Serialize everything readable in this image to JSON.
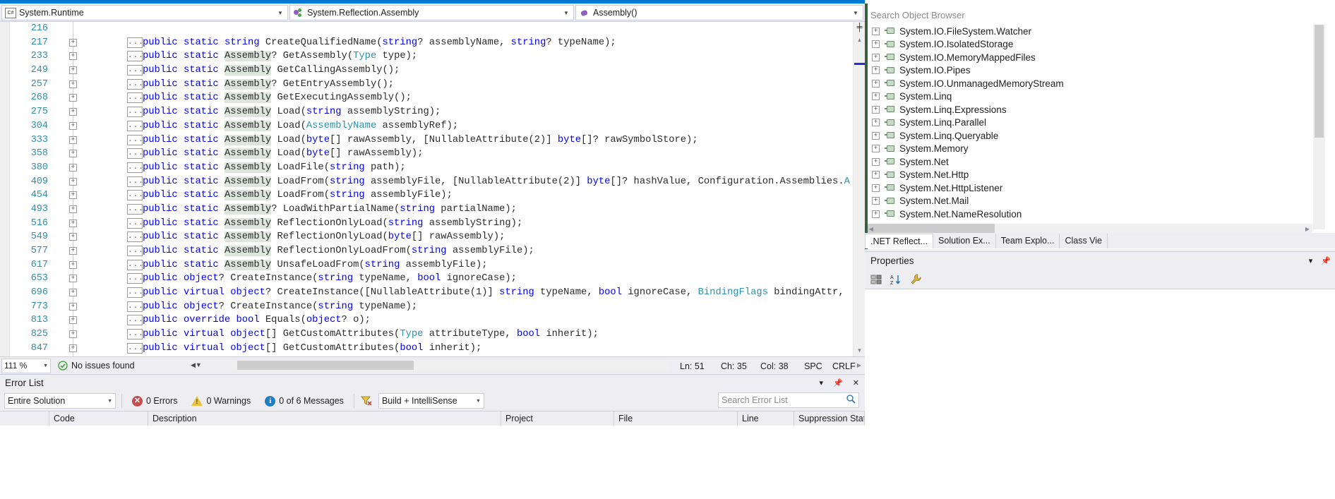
{
  "navbar": {
    "project": {
      "label": "System.Runtime",
      "icon": "csharp-icon"
    },
    "type": {
      "label": "System.Reflection.Assembly",
      "icon": "class-icon"
    },
    "member": {
      "label": "Assembly()",
      "icon": "method-icon"
    }
  },
  "editor": {
    "lines": [
      {
        "num": "216",
        "outline": false,
        "collapse": false,
        "tokens": []
      },
      {
        "num": "217",
        "outline": true,
        "collapse": true,
        "tokens": [
          {
            "t": "public ",
            "c": "k"
          },
          {
            "t": "static ",
            "c": "k"
          },
          {
            "t": "string",
            "c": "k"
          },
          {
            "t": " CreateQualifiedName(",
            "c": "id"
          },
          {
            "t": "string",
            "c": "k"
          },
          {
            "t": "? assemblyName, ",
            "c": "id"
          },
          {
            "t": "string",
            "c": "k"
          },
          {
            "t": "? typeName);",
            "c": "id"
          }
        ]
      },
      {
        "num": "233",
        "outline": true,
        "collapse": true,
        "tokens": [
          {
            "t": "public ",
            "c": "k"
          },
          {
            "t": "static ",
            "c": "k"
          },
          {
            "t": "Assembly",
            "c": "hl"
          },
          {
            "t": "? GetAssembly(",
            "c": "id"
          },
          {
            "t": "Type",
            "c": "t"
          },
          {
            "t": " type);",
            "c": "id"
          }
        ]
      },
      {
        "num": "249",
        "outline": true,
        "collapse": true,
        "tokens": [
          {
            "t": "public ",
            "c": "k"
          },
          {
            "t": "static ",
            "c": "k"
          },
          {
            "t": "Assembly",
            "c": "hl"
          },
          {
            "t": " GetCallingAssembly();",
            "c": "id"
          }
        ]
      },
      {
        "num": "257",
        "outline": true,
        "collapse": true,
        "tokens": [
          {
            "t": "public ",
            "c": "k"
          },
          {
            "t": "static ",
            "c": "k"
          },
          {
            "t": "Assembly",
            "c": "hl"
          },
          {
            "t": "? GetEntryAssembly();",
            "c": "id"
          }
        ]
      },
      {
        "num": "268",
        "outline": true,
        "collapse": true,
        "tokens": [
          {
            "t": "public ",
            "c": "k"
          },
          {
            "t": "static ",
            "c": "k"
          },
          {
            "t": "Assembly",
            "c": "hl"
          },
          {
            "t": " GetExecutingAssembly();",
            "c": "id"
          }
        ]
      },
      {
        "num": "275",
        "outline": true,
        "collapse": true,
        "tokens": [
          {
            "t": "public ",
            "c": "k"
          },
          {
            "t": "static ",
            "c": "k"
          },
          {
            "t": "Assembly",
            "c": "hl"
          },
          {
            "t": " Load(",
            "c": "id"
          },
          {
            "t": "string",
            "c": "k"
          },
          {
            "t": " assemblyString);",
            "c": "id"
          }
        ]
      },
      {
        "num": "304",
        "outline": true,
        "collapse": true,
        "tokens": [
          {
            "t": "public ",
            "c": "k"
          },
          {
            "t": "static ",
            "c": "k"
          },
          {
            "t": "Assembly",
            "c": "hl"
          },
          {
            "t": " Load(",
            "c": "id"
          },
          {
            "t": "AssemblyName",
            "c": "t"
          },
          {
            "t": " assemblyRef);",
            "c": "id"
          }
        ]
      },
      {
        "num": "333",
        "outline": true,
        "collapse": true,
        "tokens": [
          {
            "t": "public ",
            "c": "k"
          },
          {
            "t": "static ",
            "c": "k"
          },
          {
            "t": "Assembly",
            "c": "hl"
          },
          {
            "t": " Load(",
            "c": "id"
          },
          {
            "t": "byte",
            "c": "k"
          },
          {
            "t": "[] rawAssembly, [NullableAttribute(2)] ",
            "c": "id"
          },
          {
            "t": "byte",
            "c": "k"
          },
          {
            "t": "[]? rawSymbolStore);",
            "c": "id"
          }
        ]
      },
      {
        "num": "358",
        "outline": true,
        "collapse": true,
        "tokens": [
          {
            "t": "public ",
            "c": "k"
          },
          {
            "t": "static ",
            "c": "k"
          },
          {
            "t": "Assembly",
            "c": "hl"
          },
          {
            "t": " Load(",
            "c": "id"
          },
          {
            "t": "byte",
            "c": "k"
          },
          {
            "t": "[] rawAssembly);",
            "c": "id"
          }
        ]
      },
      {
        "num": "380",
        "outline": true,
        "collapse": true,
        "tokens": [
          {
            "t": "public ",
            "c": "k"
          },
          {
            "t": "static ",
            "c": "k"
          },
          {
            "t": "Assembly",
            "c": "hl"
          },
          {
            "t": " LoadFile(",
            "c": "id"
          },
          {
            "t": "string",
            "c": "k"
          },
          {
            "t": " path);",
            "c": "id"
          }
        ]
      },
      {
        "num": "409",
        "outline": true,
        "collapse": true,
        "tokens": [
          {
            "t": "public ",
            "c": "k"
          },
          {
            "t": "static ",
            "c": "k"
          },
          {
            "t": "Assembly",
            "c": "hl"
          },
          {
            "t": " LoadFrom(",
            "c": "id"
          },
          {
            "t": "string",
            "c": "k"
          },
          {
            "t": " assemblyFile, [NullableAttribute(2)] ",
            "c": "id"
          },
          {
            "t": "byte",
            "c": "k"
          },
          {
            "t": "[]? hashValue, Configuration.Assemblies.",
            "c": "id"
          },
          {
            "t": "A",
            "c": "t"
          }
        ]
      },
      {
        "num": "454",
        "outline": true,
        "collapse": true,
        "tokens": [
          {
            "t": "public ",
            "c": "k"
          },
          {
            "t": "static ",
            "c": "k"
          },
          {
            "t": "Assembly",
            "c": "hl"
          },
          {
            "t": " LoadFrom(",
            "c": "id"
          },
          {
            "t": "string",
            "c": "k"
          },
          {
            "t": " assemblyFile);",
            "c": "id"
          }
        ]
      },
      {
        "num": "493",
        "outline": true,
        "collapse": true,
        "tokens": [
          {
            "t": "public ",
            "c": "k"
          },
          {
            "t": "static ",
            "c": "k"
          },
          {
            "t": "Assembly",
            "c": "hl"
          },
          {
            "t": "? LoadWithPartialName(",
            "c": "id"
          },
          {
            "t": "string",
            "c": "k"
          },
          {
            "t": " partialName);",
            "c": "id"
          }
        ]
      },
      {
        "num": "516",
        "outline": true,
        "collapse": true,
        "tokens": [
          {
            "t": "public ",
            "c": "k"
          },
          {
            "t": "static ",
            "c": "k"
          },
          {
            "t": "Assembly",
            "c": "hl"
          },
          {
            "t": " ReflectionOnlyLoad(",
            "c": "id"
          },
          {
            "t": "string",
            "c": "k"
          },
          {
            "t": " assemblyString);",
            "c": "id"
          }
        ]
      },
      {
        "num": "549",
        "outline": true,
        "collapse": true,
        "tokens": [
          {
            "t": "public ",
            "c": "k"
          },
          {
            "t": "static ",
            "c": "k"
          },
          {
            "t": "Assembly",
            "c": "hl"
          },
          {
            "t": " ReflectionOnlyLoad(",
            "c": "id"
          },
          {
            "t": "byte",
            "c": "k"
          },
          {
            "t": "[] rawAssembly);",
            "c": "id"
          }
        ]
      },
      {
        "num": "577",
        "outline": true,
        "collapse": true,
        "tokens": [
          {
            "t": "public ",
            "c": "k"
          },
          {
            "t": "static ",
            "c": "k"
          },
          {
            "t": "Assembly",
            "c": "hl"
          },
          {
            "t": " ReflectionOnlyLoadFrom(",
            "c": "id"
          },
          {
            "t": "string",
            "c": "k"
          },
          {
            "t": " assemblyFile);",
            "c": "id"
          }
        ]
      },
      {
        "num": "617",
        "outline": true,
        "collapse": true,
        "tokens": [
          {
            "t": "public ",
            "c": "k"
          },
          {
            "t": "static ",
            "c": "k"
          },
          {
            "t": "Assembly",
            "c": "hl"
          },
          {
            "t": " UnsafeLoadFrom(",
            "c": "id"
          },
          {
            "t": "string",
            "c": "k"
          },
          {
            "t": " assemblyFile);",
            "c": "id"
          }
        ]
      },
      {
        "num": "653",
        "outline": true,
        "collapse": true,
        "tokens": [
          {
            "t": "public ",
            "c": "k"
          },
          {
            "t": "object",
            "c": "k"
          },
          {
            "t": "? CreateInstance(",
            "c": "id"
          },
          {
            "t": "string",
            "c": "k"
          },
          {
            "t": " typeName, ",
            "c": "id"
          },
          {
            "t": "bool",
            "c": "k"
          },
          {
            "t": " ignoreCase);",
            "c": "id"
          }
        ]
      },
      {
        "num": "696",
        "outline": true,
        "collapse": true,
        "tokens": [
          {
            "t": "public ",
            "c": "k"
          },
          {
            "t": "virtual ",
            "c": "k"
          },
          {
            "t": "object",
            "c": "k"
          },
          {
            "t": "? CreateInstance([NullableAttribute(1)] ",
            "c": "id"
          },
          {
            "t": "string",
            "c": "k"
          },
          {
            "t": " typeName, ",
            "c": "id"
          },
          {
            "t": "bool",
            "c": "k"
          },
          {
            "t": " ignoreCase, ",
            "c": "id"
          },
          {
            "t": "BindingFlags",
            "c": "t"
          },
          {
            "t": " bindingAttr,",
            "c": "id"
          }
        ]
      },
      {
        "num": "773",
        "outline": true,
        "collapse": true,
        "tokens": [
          {
            "t": "public ",
            "c": "k"
          },
          {
            "t": "object",
            "c": "k"
          },
          {
            "t": "? CreateInstance(",
            "c": "id"
          },
          {
            "t": "string",
            "c": "k"
          },
          {
            "t": " typeName);",
            "c": "id"
          }
        ]
      },
      {
        "num": "813",
        "outline": true,
        "collapse": true,
        "tokens": [
          {
            "t": "public ",
            "c": "k"
          },
          {
            "t": "override ",
            "c": "k"
          },
          {
            "t": "bool",
            "c": "k"
          },
          {
            "t": " Equals(",
            "c": "id"
          },
          {
            "t": "object",
            "c": "k"
          },
          {
            "t": "? o);",
            "c": "id"
          }
        ]
      },
      {
        "num": "825",
        "outline": true,
        "collapse": true,
        "tokens": [
          {
            "t": "public ",
            "c": "k"
          },
          {
            "t": "virtual ",
            "c": "k"
          },
          {
            "t": "object",
            "c": "k"
          },
          {
            "t": "[] GetCustomAttributes(",
            "c": "id"
          },
          {
            "t": "Type",
            "c": "t"
          },
          {
            "t": " attributeType, ",
            "c": "id"
          },
          {
            "t": "bool",
            "c": "k"
          },
          {
            "t": " inherit);",
            "c": "id"
          }
        ]
      },
      {
        "num": "847",
        "outline": true,
        "collapse": true,
        "tokens": [
          {
            "t": "public ",
            "c": "k"
          },
          {
            "t": "virtual ",
            "c": "k"
          },
          {
            "t": "object",
            "c": "k"
          },
          {
            "t": "[] GetCustomAttributes(",
            "c": "id"
          },
          {
            "t": "bool",
            "c": "k"
          },
          {
            "t": " inherit);",
            "c": "id"
          }
        ]
      }
    ]
  },
  "status": {
    "zoom": "111 %",
    "issues": "No issues found",
    "ln_label": "Ln: 51",
    "ch_label": "Ch: 35",
    "col_label": "Col: 38",
    "spaces": "SPC",
    "lineending": "CRLF"
  },
  "object_browser": {
    "search_placeholder": "Search Object Browser",
    "items": [
      {
        "label": "System.IO.FileSystem.Watcher"
      },
      {
        "label": "System.IO.IsolatedStorage"
      },
      {
        "label": "System.IO.MemoryMappedFiles"
      },
      {
        "label": "System.IO.Pipes"
      },
      {
        "label": "System.IO.UnmanagedMemoryStream"
      },
      {
        "label": "System.Linq"
      },
      {
        "label": "System.Linq.Expressions"
      },
      {
        "label": "System.Linq.Parallel"
      },
      {
        "label": "System.Linq.Queryable"
      },
      {
        "label": "System.Memory"
      },
      {
        "label": "System.Net"
      },
      {
        "label": "System.Net.Http"
      },
      {
        "label": "System.Net.HttpListener"
      },
      {
        "label": "System.Net.Mail"
      },
      {
        "label": "System.Net.NameResolution"
      }
    ],
    "tabs": [
      {
        "label": ".NET Reflect...",
        "active": true
      },
      {
        "label": "Solution Ex...",
        "active": false
      },
      {
        "label": "Team Explo...",
        "active": false
      },
      {
        "label": "Class Vie",
        "active": false
      }
    ]
  },
  "properties": {
    "title": "Properties",
    "toolbar_icons": [
      "categorized-icon",
      "alphabetical-icon",
      "properties-icon"
    ]
  },
  "error_list": {
    "title": "Error List",
    "scope_filter": "Entire Solution",
    "errors": "0 Errors",
    "warnings": "0 Warnings",
    "messages": "0 of 6 Messages",
    "build_filter": "Build + IntelliSense",
    "search_placeholder": "Search Error List",
    "columns": [
      "",
      "Code",
      "Description",
      "Project",
      "File",
      "Line",
      "Suppression State"
    ]
  },
  "colors": {
    "accent": "#0078d4",
    "keyword": "#0000ff",
    "type": "#2b91af",
    "highlight": "#dde6dc",
    "chrome": "#eeeef2"
  }
}
